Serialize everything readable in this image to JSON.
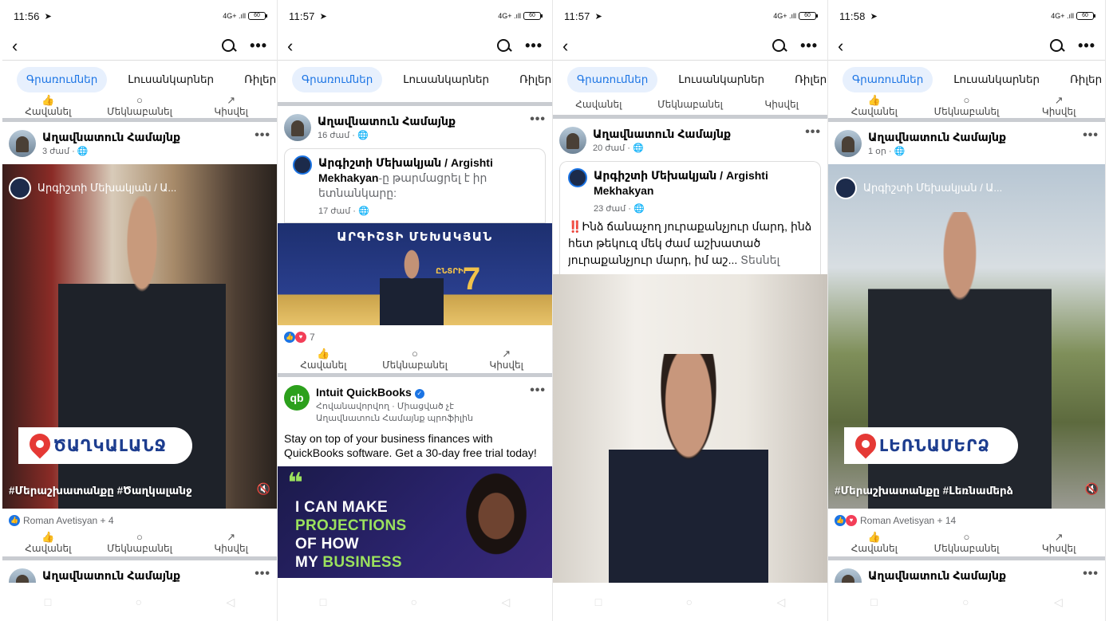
{
  "status": {
    "p1_time": "11:56",
    "p2_time": "11:57",
    "p3_time": "11:57",
    "p4_time": "11:58",
    "network": "4G+ .ıll",
    "battery": "60"
  },
  "tabs": [
    "Գրառումներ",
    "Լուսանկարներ",
    "Ռիլեր"
  ],
  "actions": {
    "like": "Հավանել",
    "comment": "Մեկնաբանել",
    "share": "Կիսվել"
  },
  "page_name": "Աղավնատուն Համայնք",
  "panel1": {
    "post_time": "3 ժամ",
    "overlay_author": "Արգիշտի Մեխակյան / Ա...",
    "location_label": "ԾԱՂԿԱԼԱՆՋ",
    "hashtags": "#Մերաշխատանքը #Ծաղկալանջ",
    "reactions": "Roman Avetisyan + 4"
  },
  "panel2": {
    "post_time": "16 ժամ",
    "shared_author": "Արգիշտի Մեխակյան / Argishti Mekhakyan",
    "shared_action": "-ը թարմացրել է իր ետնանկարը:",
    "shared_time": "17 ժամ",
    "banner_title": "ԱՐԳԻՇՏԻ ՄԵԽԱԿՅԱՆ",
    "banner_badge": "ԸՆՏՐԻՐ",
    "banner_number": "7",
    "reaction_count": "7",
    "ad_name": "Intuit QuickBooks",
    "ad_logo": "qb",
    "ad_sub": "Հովանավորվող · Միացված չէ Աղավնատուն Համայնք պրոֆիլին",
    "ad_text": "Stay on top of your business finances with QuickBooks software. Get a 30-day free trial today!",
    "ad_quote": "❝",
    "ad_line1": "I CAN MAKE",
    "ad_line2": "PROJECTIONS",
    "ad_line3": "OF HOW",
    "ad_line4_a": "MY ",
    "ad_line4_b": "BUSINESS"
  },
  "panel3": {
    "post_time": "20 ժամ",
    "shared_author": "Արգիշտի Մեխակյան / Argishti Mekhakyan",
    "shared_time": "23 ժամ",
    "text": "‼️Ինձ ճանաչող յուրաքանչյուր մարդ, ինձ հետ թեկուզ մեկ ժամ աշխատած յուրաքանչյուր մարդ, իմ աշ...",
    "see_more": "Տեսնել ավելին"
  },
  "panel4": {
    "post_time": "1 օր",
    "overlay_author": "Արգիշտի Մեխակյան / Ա...",
    "location_label": "ԼԵՌՆԱՄԵՐՁ",
    "hashtags": "#Մերաշխատանքը #Լեռնամերձ",
    "reactions": "Roman Avetisyan + 14"
  },
  "icons": [
    "back-arrow-icon",
    "search-icon",
    "more-dots-icon",
    "globe-icon",
    "mute-icon",
    "like-icon",
    "comment-icon",
    "share-icon",
    "location-pin-icon"
  ],
  "colors": {
    "accent": "#1b74e4",
    "tab_bg": "#e7f0fd",
    "pin": "#e53935",
    "quickbooks": "#2ca01c"
  }
}
